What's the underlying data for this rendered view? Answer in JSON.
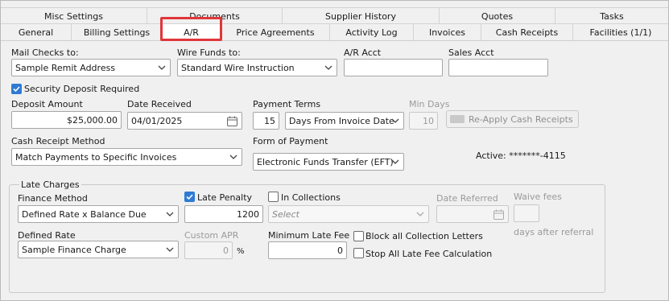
{
  "tabs": {
    "row1": [
      "Misc Settings",
      "Documents",
      "Supplier History",
      "Quotes",
      "Tasks"
    ],
    "row2": [
      "General",
      "Billing Settings",
      "A/R",
      "Price Agreements",
      "Activity Log",
      "Invoices",
      "Cash Receipts",
      "Facilities (1/1)"
    ],
    "active": "A/R"
  },
  "form": {
    "mail_checks_label": "Mail Checks to:",
    "mail_checks_value": "Sample Remit Address",
    "wire_funds_label": "Wire Funds to:",
    "wire_funds_value": "Standard Wire Instruction",
    "ar_acct_label": "A/R Acct",
    "ar_acct_value": "",
    "sales_acct_label": "Sales Acct",
    "sales_acct_value": "",
    "security_deposit_label": "Security Deposit Required",
    "security_deposit_checked": true,
    "deposit_amount_label": "Deposit Amount",
    "deposit_amount_value": "$25,000.00",
    "date_received_label": "Date Received",
    "date_received_value": "04/01/2025",
    "payment_terms_label": "Payment Terms",
    "payment_terms_days": "15",
    "payment_terms_value": "Days From Invoice Date",
    "min_days_label": "Min Days",
    "min_days_value": "10",
    "reapply_button": "Re-Apply Cash Receipts",
    "cash_receipt_method_label": "Cash Receipt Method",
    "cash_receipt_method_value": "Match Payments to Specific Invoices",
    "form_of_payment_label": "Form of Payment",
    "form_of_payment_value": "Electronic Funds Transfer (EFT)",
    "active_account_text": "Active: *******-4115"
  },
  "late_charges": {
    "group_label": "Late Charges",
    "finance_method_label": "Finance Method",
    "finance_method_value": "Defined Rate x Balance Due",
    "late_penalty_label": "Late Penalty",
    "late_penalty_checked": true,
    "late_penalty_value": "1200",
    "in_collections_label": "In Collections",
    "in_collections_checked": false,
    "collections_select_placeholder": "Select",
    "date_referred_label": "Date Referred",
    "date_referred_value": "",
    "waive_fees_label": "Waive fees",
    "waive_fees_value": "",
    "days_after_referral_label": "days after referral",
    "defined_rate_label": "Defined Rate",
    "defined_rate_value": "Sample Finance Charge",
    "custom_apr_label": "Custom APR",
    "custom_apr_value": "0",
    "custom_apr_unit": "%",
    "minimum_late_fee_label": "Minimum Late Fee",
    "minimum_late_fee_value": "0",
    "block_collection_letters_label": "Block all Collection Letters",
    "block_collection_letters_checked": false,
    "stop_late_fee_label": "Stop All Late Fee Calculation",
    "stop_late_fee_checked": false
  },
  "colors": {
    "accent": "#2f7bd4",
    "highlight": "#e0363a"
  }
}
